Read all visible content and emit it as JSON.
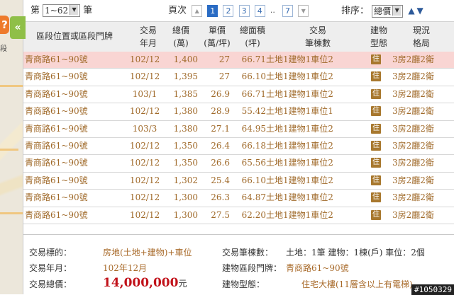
{
  "map": {
    "orange_marker_glyph": "?",
    "label": "段",
    "collapse_glyph": "«"
  },
  "topbar": {
    "count_prefix": "第",
    "count_value": "1~62",
    "count_suffix": "筆",
    "page_label": "頁次",
    "prev_glyph": "▲",
    "pages": [
      "1",
      "2",
      "3",
      "4"
    ],
    "current_page": "1",
    "ellipsis": "..",
    "last_page": "7",
    "next_glyph": "▼",
    "sort_label": "排序：",
    "sort_value": "總價",
    "sort_up": "▲",
    "sort_down": "▼"
  },
  "columns": {
    "addr": "區段位置或區段門牌",
    "ym_1": "交易",
    "ym_2": "年月",
    "price_1": "總價",
    "price_2": "(萬)",
    "unit_1": "單價",
    "unit_2": "(萬/坪)",
    "area_1": "總面積",
    "area_2": "(坪)",
    "trans_1": "交易",
    "trans_2": "筆棟數",
    "btype_1": "建物",
    "btype_2": "型態",
    "layout_1": "現況",
    "layout_2": "格局"
  },
  "rows": [
    {
      "addr": "青商路61~90號",
      "ym": "102/12",
      "price": "1,400",
      "unit": "27",
      "area": "66.71",
      "trans": "土地1建物1車位2",
      "btype": "住",
      "layout": "3房2廳2衛"
    },
    {
      "addr": "青商路61~90號",
      "ym": "102/12",
      "price": "1,395",
      "unit": "27",
      "area": "66.10",
      "trans": "土地1建物1車位2",
      "btype": "住",
      "layout": "3房2廳2衛"
    },
    {
      "addr": "青商路61~90號",
      "ym": "103/1",
      "price": "1,385",
      "unit": "26.9",
      "area": "66.71",
      "trans": "土地1建物1車位2",
      "btype": "住",
      "layout": "3房2廳2衛"
    },
    {
      "addr": "青商路61~90號",
      "ym": "102/12",
      "price": "1,380",
      "unit": "28.9",
      "area": "55.42",
      "trans": "土地1建物1車位1",
      "btype": "住",
      "layout": "3房2廳2衛"
    },
    {
      "addr": "青商路61~90號",
      "ym": "103/3",
      "price": "1,380",
      "unit": "27.1",
      "area": "64.95",
      "trans": "土地1建物1車位2",
      "btype": "住",
      "layout": "3房2廳2衛"
    },
    {
      "addr": "青商路61~90號",
      "ym": "102/12",
      "price": "1,350",
      "unit": "26.4",
      "area": "66.18",
      "trans": "土地1建物1車位2",
      "btype": "住",
      "layout": "3房2廳2衛"
    },
    {
      "addr": "青商路61~90號",
      "ym": "102/12",
      "price": "1,350",
      "unit": "26.6",
      "area": "65.56",
      "trans": "土地1建物1車位2",
      "btype": "住",
      "layout": "3房2廳2衛"
    },
    {
      "addr": "青商路61~90號",
      "ym": "102/12",
      "price": "1,302",
      "unit": "25.4",
      "area": "66.10",
      "trans": "土地1建物1車位2",
      "btype": "住",
      "layout": "3房2廳2衛"
    },
    {
      "addr": "青商路61~90號",
      "ym": "102/12",
      "price": "1,300",
      "unit": "26.3",
      "area": "64.87",
      "trans": "土地1建物1車位2",
      "btype": "住",
      "layout": "3房2廳2衛"
    },
    {
      "addr": "青商路61~90號",
      "ym": "102/12",
      "price": "1,300",
      "unit": "27.5",
      "area": "62.20",
      "trans": "土地1建物1車位2",
      "btype": "住",
      "layout": "3房2廳2衛"
    }
  ],
  "detail": {
    "target_label": "交易標的：",
    "target_value": "房地(土地+建物)+車位",
    "date_label": "交易年月：",
    "date_value": "102年12月",
    "total_label": "交易總價：",
    "total_value": "14,000,000",
    "total_unit": "元",
    "count_label": "交易筆棟數：",
    "count_value": "土地：1筆 建物：1棟(戶) 車位：2個",
    "addr_label": "建物區段門牌：",
    "addr_value": "青商路61~90號",
    "type_label": "建物型態：",
    "type_value": "住宅大樓(11層含以上有電梯)"
  },
  "watermark": "#1050329",
  "colors": {
    "highlight_row": "#f9d5d3",
    "value_brown": "#a06a2a",
    "total_red": "#c1121a",
    "current_page": "#2a6cc4",
    "collapse_tab": "#8fbf48"
  }
}
